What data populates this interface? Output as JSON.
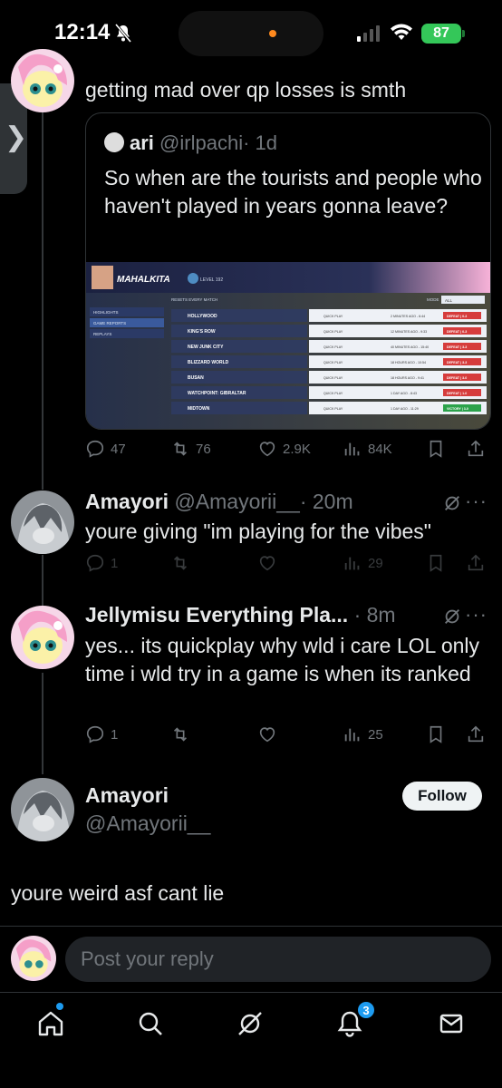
{
  "status_bar": {
    "time": "12:14",
    "battery": "87"
  },
  "thread": {
    "parent_text": "getting mad over qp losses is smth",
    "quote": {
      "name": "ari",
      "handle": "@irlpachi",
      "time": "· 1d",
      "text": "So when are the tourists and people who haven't played in years gonna leave?",
      "image": {
        "player_name": "MAHALKITA",
        "level": "LEVEL 192",
        "resets": "RESETS EVERY MATCH",
        "mode_label": "MODE",
        "mode_value": "ALL",
        "sidebar": [
          "HIGHLIGHTS",
          "GAME REPORTS",
          "REPLAYS"
        ],
        "matches": [
          {
            "map": "HOLLYWOOD",
            "mode": "QUICK PLAY",
            "time": "2 MINUTES AGO - 6:44",
            "result": "DEFEAT | 0-3"
          },
          {
            "map": "KING'S ROW",
            "mode": "QUICK PLAY",
            "time": "12 MINUTES AGO - 9:33",
            "result": "DEFEAT | 0-3"
          },
          {
            "map": "NEW JUNK CITY",
            "mode": "QUICK PLAY",
            "time": "40 MINUTES AGO - 15:40",
            "result": "DEFEAT | 3-3"
          },
          {
            "map": "BLIZZARD WORLD",
            "mode": "QUICK PLAY",
            "time": "18 HOURS AGO - 10:54",
            "result": "DEFEAT | 3-3"
          },
          {
            "map": "BUSAN",
            "mode": "QUICK PLAY",
            "time": "18 HOURS AGO - 9:41",
            "result": "DEFEAT | 3-0"
          },
          {
            "map": "WATCHPOINT: GIBRALTAR",
            "mode": "QUICK PLAY",
            "time": "1 DAY AGO - 8:43",
            "result": "DEFEAT | 1-0"
          },
          {
            "map": "MIDTOWN",
            "mode": "QUICK PLAY",
            "time": "1 DAY AGO - 11:29",
            "result": "VICTORY | 3-0"
          }
        ]
      }
    },
    "parent_actions": {
      "replies": "47",
      "reposts": "76",
      "likes": "2.9K",
      "views": "84K"
    },
    "replies": [
      {
        "name": "Amayori",
        "handle": "@Amayorii__",
        "time": "· 20m",
        "text": "youre giving \"im playing for the vibes\"",
        "replies": "1",
        "views": "29"
      },
      {
        "name": "Jellymisu Everything Pla...",
        "handle": "",
        "time": "· 8m",
        "text": "yes... its quickplay why wld i care LOL only time i wld try in a game is when its ranked",
        "replies": "1",
        "views": "25"
      }
    ],
    "focused": {
      "name": "Amayori",
      "handle": "@Amayorii__",
      "follow_label": "Follow",
      "text": "youre weird asf cant lie"
    }
  },
  "composer": {
    "placeholder": "Post your reply"
  },
  "nav": {
    "notifications_badge": "3"
  },
  "colors": {
    "accent": "#1d9bf0",
    "background": "#000000",
    "muted": "#71767b",
    "battery": "#34c759"
  }
}
